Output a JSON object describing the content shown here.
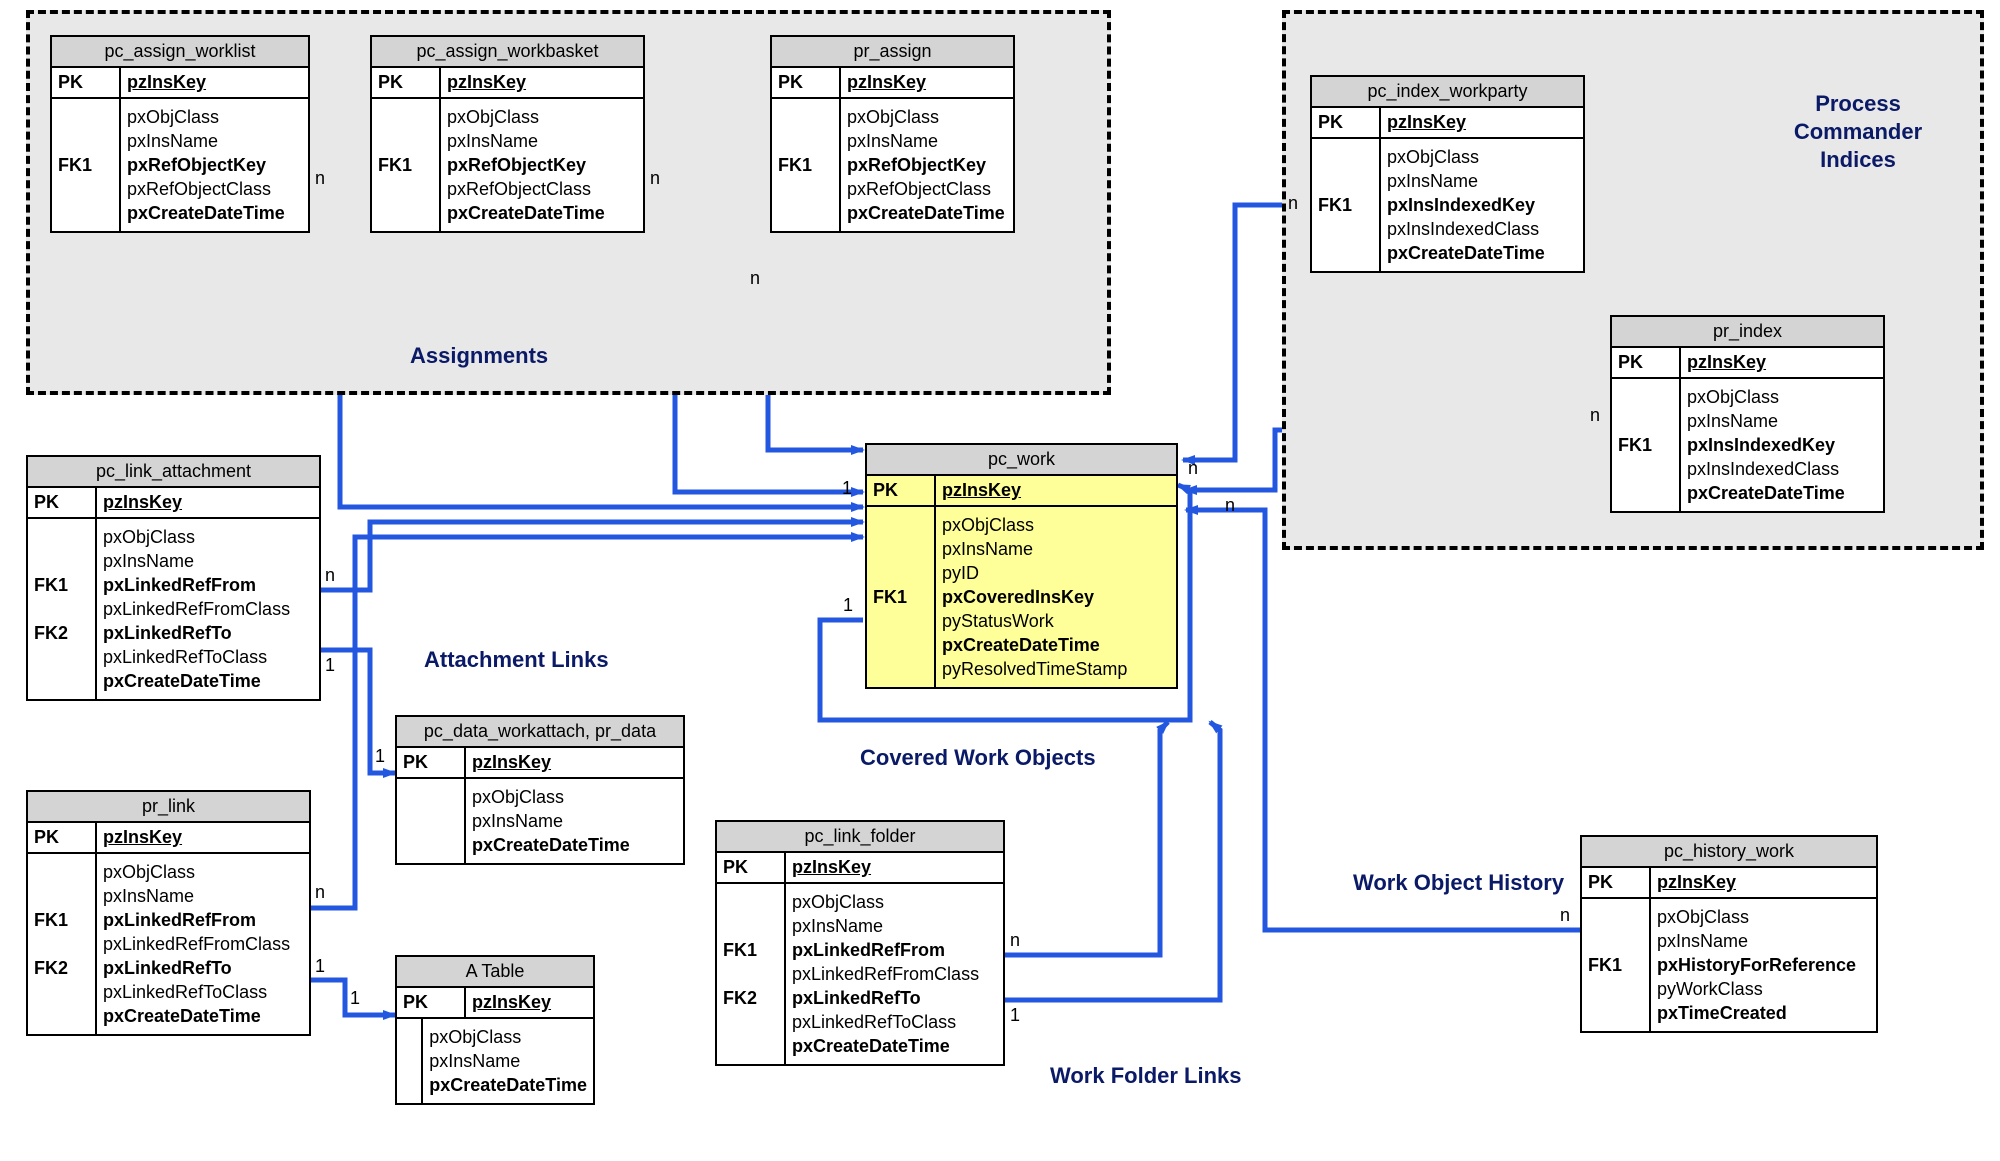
{
  "groups": {
    "assignments": "Assignments",
    "indices": "Process Commander Indices"
  },
  "labels": {
    "attachment_links": "Attachment Links",
    "covered_work": "Covered Work Objects",
    "work_history": "Work Object History",
    "work_folder_links": "Work Folder Links"
  },
  "cardinality": {
    "n": "n",
    "one": "1"
  },
  "entities": {
    "pc_assign_worklist": {
      "title": "pc_assign_worklist",
      "pk_label": "PK",
      "pk_value": "pzInsKey",
      "keys": [
        "",
        "",
        "FK1",
        "",
        ""
      ],
      "cols": [
        "pxObjClass",
        "pxInsName",
        "pxRefObjectKey",
        "pxRefObjectClass",
        "pxCreateDateTime"
      ],
      "bold": [
        false,
        false,
        true,
        false,
        true
      ]
    },
    "pc_assign_workbasket": {
      "title": "pc_assign_workbasket",
      "pk_label": "PK",
      "pk_value": "pzInsKey",
      "keys": [
        "",
        "",
        "FK1",
        "",
        ""
      ],
      "cols": [
        "pxObjClass",
        "pxInsName",
        "pxRefObjectKey",
        "pxRefObjectClass",
        "pxCreateDateTime"
      ],
      "bold": [
        false,
        false,
        true,
        false,
        true
      ]
    },
    "pr_assign": {
      "title": "pr_assign",
      "pk_label": "PK",
      "pk_value": "pzInsKey",
      "keys": [
        "",
        "",
        "FK1",
        "",
        ""
      ],
      "cols": [
        "pxObjClass",
        "pxInsName",
        "pxRefObjectKey",
        "pxRefObjectClass",
        "pxCreateDateTime"
      ],
      "bold": [
        false,
        false,
        true,
        false,
        true
      ]
    },
    "pc_link_attachment": {
      "title": "pc_link_attachment",
      "pk_label": "PK",
      "pk_value": "pzInsKey",
      "keys": [
        "",
        "",
        "FK1",
        "",
        "FK2",
        "",
        ""
      ],
      "cols": [
        "pxObjClass",
        "pxInsName",
        "pxLinkedRefFrom",
        "pxLinkedRefFromClass",
        "pxLinkedRefTo",
        "pxLinkedRefToClass",
        "pxCreateDateTime"
      ],
      "bold": [
        false,
        false,
        true,
        false,
        true,
        false,
        true
      ]
    },
    "pr_link": {
      "title": "pr_link",
      "pk_label": "PK",
      "pk_value": "pzInsKey",
      "keys": [
        "",
        "",
        "FK1",
        "",
        "FK2",
        "",
        ""
      ],
      "cols": [
        "pxObjClass",
        "pxInsName",
        "pxLinkedRefFrom",
        "pxLinkedRefFromClass",
        "pxLinkedRefTo",
        "pxLinkedRefToClass",
        "pxCreateDateTime"
      ],
      "bold": [
        false,
        false,
        true,
        false,
        true,
        false,
        true
      ]
    },
    "pc_data_workattach": {
      "title": "pc_data_workattach, pr_data",
      "pk_label": "PK",
      "pk_value": "pzInsKey",
      "keys": [
        "",
        "",
        ""
      ],
      "cols": [
        "pxObjClass",
        "pxInsName",
        "pxCreateDateTime"
      ],
      "bold": [
        false,
        false,
        true
      ]
    },
    "a_table": {
      "title": "A Table",
      "pk_label": "PK",
      "pk_value": "pzInsKey",
      "keys": [
        "",
        "",
        ""
      ],
      "cols": [
        "pxObjClass",
        "pxInsName",
        "pxCreateDateTime"
      ],
      "bold": [
        false,
        false,
        true
      ]
    },
    "pc_link_folder": {
      "title": "pc_link_folder",
      "pk_label": "PK",
      "pk_value": "pzInsKey",
      "keys": [
        "",
        "",
        "FK1",
        "",
        "FK2",
        "",
        ""
      ],
      "cols": [
        "pxObjClass",
        "pxInsName",
        "pxLinkedRefFrom",
        "pxLinkedRefFromClass",
        "pxLinkedRefTo",
        "pxLinkedRefToClass",
        "pxCreateDateTime"
      ],
      "bold": [
        false,
        false,
        true,
        false,
        true,
        false,
        true
      ]
    },
    "pc_work": {
      "title": "pc_work",
      "pk_label": "PK",
      "pk_value": "pzInsKey",
      "keys": [
        "",
        "",
        "",
        "FK1",
        "",
        "",
        ""
      ],
      "cols": [
        "pxObjClass",
        "pxInsName",
        "pyID",
        "pxCoveredInsKey",
        "pyStatusWork",
        "pxCreateDateTime",
        "pyResolvedTimeStamp"
      ],
      "bold": [
        false,
        false,
        false,
        true,
        false,
        true,
        false
      ]
    },
    "pc_index_workparty": {
      "title": "pc_index_workparty",
      "pk_label": "PK",
      "pk_value": "pzInsKey",
      "keys": [
        "",
        "",
        "FK1",
        "",
        ""
      ],
      "cols": [
        "pxObjClass",
        "pxInsName",
        "pxInsIndexedKey",
        "pxInsIndexedClass",
        "pxCreateDateTime"
      ],
      "bold": [
        false,
        false,
        true,
        false,
        true
      ]
    },
    "pr_index": {
      "title": "pr_index",
      "pk_label": "PK",
      "pk_value": "pzInsKey",
      "keys": [
        "",
        "",
        "FK1",
        "",
        ""
      ],
      "cols": [
        "pxObjClass",
        "pxInsName",
        "pxInsIndexedKey",
        "pxInsIndexedClass",
        "pxCreateDateTime"
      ],
      "bold": [
        false,
        false,
        true,
        false,
        true
      ]
    },
    "pc_history_work": {
      "title": "pc_history_work",
      "pk_label": "PK",
      "pk_value": "pzInsKey",
      "keys": [
        "",
        "",
        "FK1",
        "",
        ""
      ],
      "cols": [
        "pxObjClass",
        "pxInsName",
        "pxHistoryForReference",
        "pyWorkClass",
        "pxTimeCreated"
      ],
      "bold": [
        false,
        false,
        true,
        false,
        true
      ]
    }
  }
}
